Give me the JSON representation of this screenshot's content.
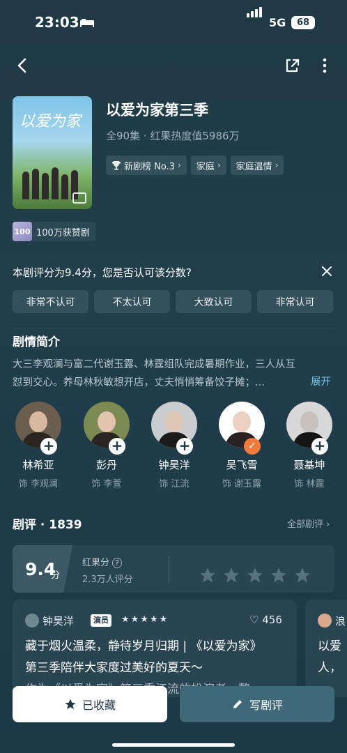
{
  "status": {
    "time": "23:03",
    "network": "5G",
    "battery": "68"
  },
  "show": {
    "title": "以爱为家第三季",
    "meta": "全90集 · 红果热度值5986万",
    "tags": [
      {
        "label": "新剧榜 No.3",
        "icon": "trophy-icon"
      },
      {
        "label": "家庭"
      },
      {
        "label": "家庭温情"
      }
    ],
    "award": {
      "logo": "100",
      "label": "100万获赞剧"
    }
  },
  "poster": {
    "text": "以爱为家"
  },
  "rating_prompt": {
    "question": "本剧评分为9.4分，您是否认可该分数?",
    "options": [
      "非常不认可",
      "不太认可",
      "大致认可",
      "非常认可"
    ]
  },
  "synopsis": {
    "title": "剧情简介",
    "line1": "大三李观澜与富二代谢玉露、林霆组队完成暑期作业，三人从互",
    "line2": "怼到交心。养母林秋敏想开店，丈夫悄悄筹备饺子摊；...",
    "expand": "展开"
  },
  "cast": [
    {
      "name": "林希亚",
      "role": "饰 李观澜",
      "followed": false
    },
    {
      "name": "彭丹",
      "role": "饰 李萱",
      "followed": false
    },
    {
      "name": "钟昊洋",
      "role": "饰 江流",
      "followed": false
    },
    {
      "name": "吴飞雪",
      "role": "饰 谢玉露",
      "followed": true
    },
    {
      "name": "聂基坤",
      "role": "饰 林霆",
      "followed": false
    }
  ],
  "reviews": {
    "title": "剧评 · 1839",
    "all_label": "全部剧评",
    "score": "9.4",
    "score_unit": "分",
    "score_label": "红果分",
    "score_count": "2.3万人评分",
    "card": {
      "author": "钟昊洋",
      "badge": "演员",
      "stars": "★★★★★",
      "likes": "456",
      "line1": "藏于烟火温柔，静待岁月归期 | 《以爱为家》",
      "line2": "第三季陪伴大家度过美好的夏天～",
      "line3": "作为《以爱为家》第三季江流的扮演者，整"
    },
    "card2": {
      "author": "浪",
      "line1": "以爱",
      "line2": "人，"
    }
  },
  "actions": {
    "favorite": "已收藏",
    "write": "写剧评"
  }
}
